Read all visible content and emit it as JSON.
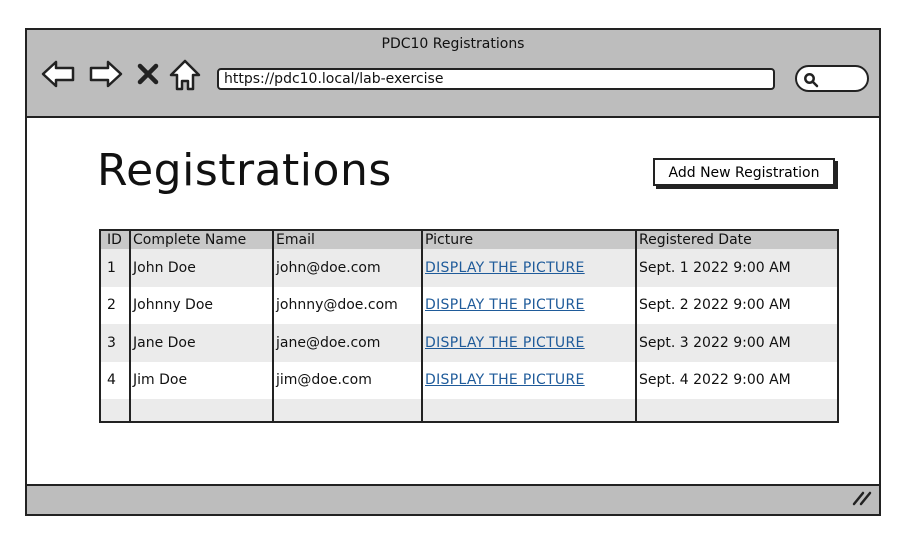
{
  "window": {
    "title": "PDC10 Registrations",
    "url": "https://pdc10.local/lab-exercise"
  },
  "icons": {
    "back": "arrow-left-icon",
    "forward": "arrow-right-icon",
    "stop": "close-x-icon",
    "home": "home-icon",
    "search": "search-icon",
    "resize": "resize-grip-icon"
  },
  "page": {
    "title": "Registrations",
    "add_button_label": "Add New Registration"
  },
  "table": {
    "headers": {
      "id": "ID",
      "name": "Complete Name",
      "email": "Email",
      "picture": "Picture",
      "date": "Registered Date"
    },
    "rows": [
      {
        "id": "1",
        "name": "John Doe",
        "email": "john@doe.com",
        "picture": "DISPLAY THE PICTURE",
        "date": "Sept. 1 2022 9:00 AM"
      },
      {
        "id": "2",
        "name": "Johnny Doe",
        "email": "johnny@doe.com",
        "picture": "DISPLAY THE PICTURE",
        "date": "Sept. 2 2022 9:00 AM"
      },
      {
        "id": "3",
        "name": "Jane Doe",
        "email": "jane@doe.com",
        "picture": "DISPLAY THE PICTURE",
        "date": "Sept. 3 2022 9:00 AM"
      },
      {
        "id": "4",
        "name": "Jim Doe",
        "email": "jim@doe.com",
        "picture": "DISPLAY THE PICTURE",
        "date": "Sept. 4 2022 9:00 AM"
      }
    ]
  },
  "colors": {
    "chrome": "#bdbdbd",
    "link": "#1f5b9a",
    "header_row": "#c8c8c8",
    "alt_row": "#ebebeb"
  }
}
